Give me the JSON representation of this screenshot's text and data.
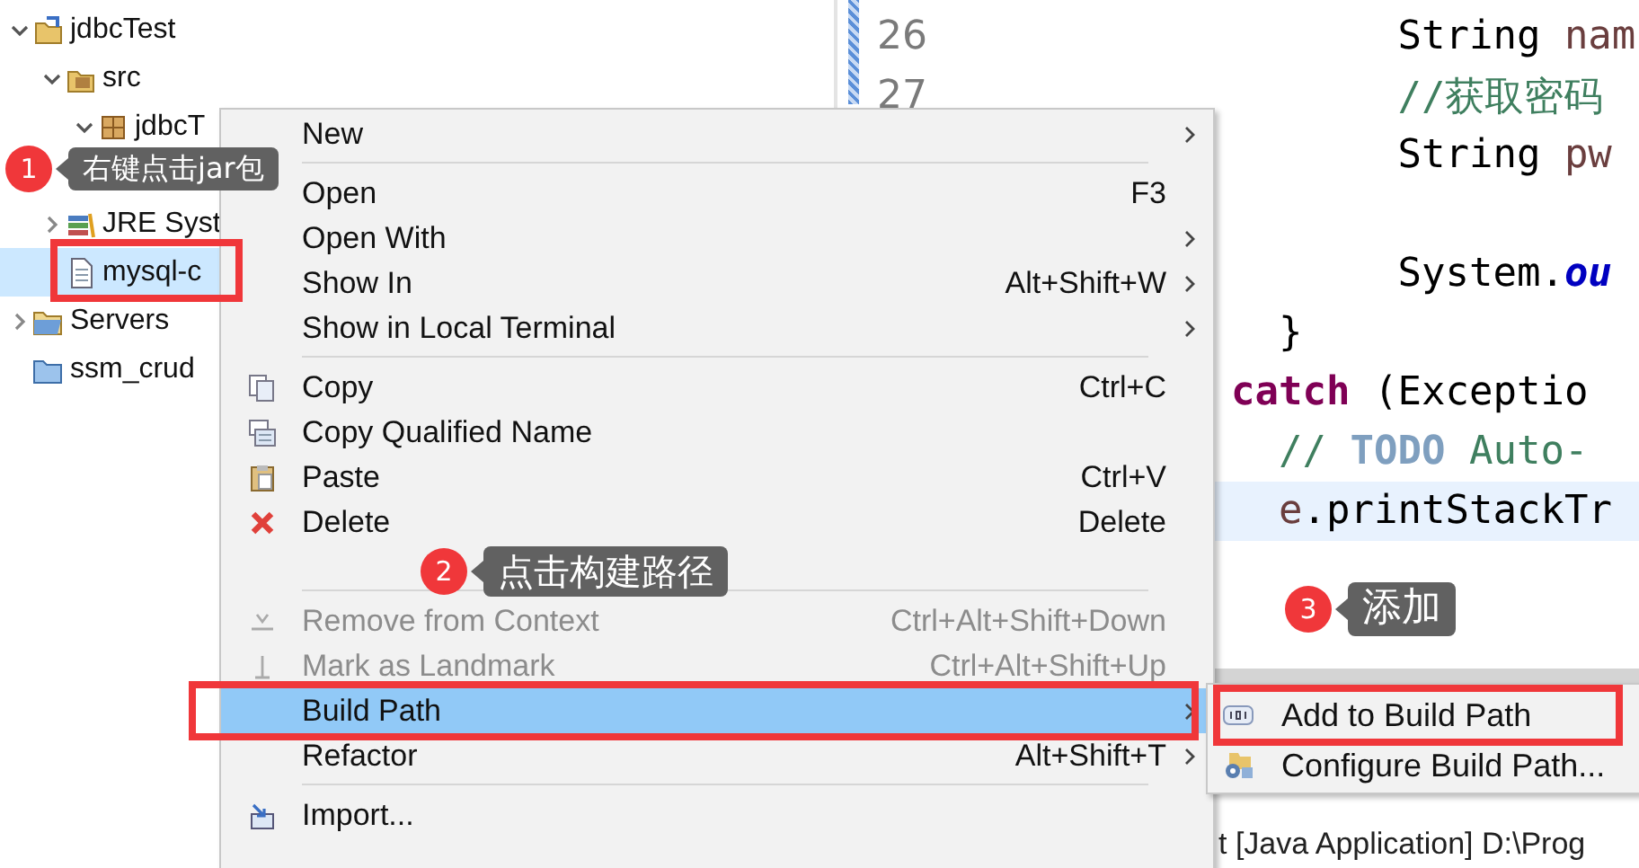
{
  "project_explorer": {
    "items": [
      {
        "label": "jdbcTest",
        "kind": "project",
        "expanded": true,
        "selected": false,
        "children": [
          {
            "label": "src",
            "kind": "sourcefolder",
            "expanded": true,
            "selected": false,
            "children": [
              {
                "label": "jdbcT",
                "kind": "package",
                "expanded": true,
                "selected": false
              }
            ]
          },
          {
            "label": "JRE Syst",
            "kind": "library",
            "expanded": false,
            "selected": false
          },
          {
            "label": "mysql-c",
            "kind": "jarfile",
            "selected": true
          }
        ]
      },
      {
        "label": "Servers",
        "kind": "serverfolder",
        "expanded": false,
        "selected": false
      },
      {
        "label": "ssm_crud",
        "kind": "folder",
        "selected": false
      }
    ]
  },
  "editor": {
    "lines": [
      {
        "number": "26",
        "kind": "inner",
        "current": false,
        "segments": [
          {
            "text": "String ",
            "kind": "plain"
          },
          {
            "text": "nam",
            "kind": "variable"
          }
        ]
      },
      {
        "number": "27",
        "kind": "inner",
        "current": false,
        "segments": [
          {
            "text": "//获取密码",
            "kind": "comment"
          }
        ]
      },
      {
        "kind": "inner",
        "current": false,
        "segments": [
          {
            "text": "String ",
            "kind": "plain"
          },
          {
            "text": "pw",
            "kind": "variable"
          }
        ]
      },
      {
        "kind": "inner",
        "current": false,
        "blank_before": true,
        "segments": [
          {
            "text": "System.",
            "kind": "plain"
          },
          {
            "text": "ou",
            "kind": "field"
          }
        ]
      },
      {
        "kind": "block",
        "current": false,
        "segments": [
          {
            "text": "}",
            "kind": "plain"
          }
        ]
      },
      {
        "kind": "outer",
        "current": false,
        "segments": [
          {
            "text": "catch",
            "kind": "keyword"
          },
          {
            "text": " (Exceptio",
            "kind": "plain"
          }
        ]
      },
      {
        "kind": "block",
        "current": false,
        "segments": [
          {
            "text": "// ",
            "kind": "comment"
          },
          {
            "text": "TODO",
            "kind": "todo"
          },
          {
            "text": " Auto-",
            "kind": "comment"
          }
        ]
      },
      {
        "kind": "block",
        "current": true,
        "segments": [
          {
            "text": "e",
            "kind": "variable"
          },
          {
            "text": ".printStackTr",
            "kind": "plain"
          }
        ]
      }
    ],
    "console_text": "t [Java Application] D:\\Prog"
  },
  "context_menu": {
    "items": [
      {
        "kind": "item",
        "label": "New",
        "submenu": true,
        "disabled": false,
        "selected": false
      },
      {
        "kind": "separator"
      },
      {
        "kind": "item",
        "label": "Open",
        "shortcut": "F3",
        "submenu": false,
        "disabled": false,
        "selected": false
      },
      {
        "kind": "item",
        "label": "Open With",
        "submenu": true,
        "disabled": false,
        "selected": false
      },
      {
        "kind": "item",
        "label": "Show In",
        "shortcut": "Alt+Shift+W",
        "submenu": true,
        "disabled": false,
        "selected": false
      },
      {
        "kind": "item",
        "label": "Show in Local Terminal",
        "submenu": true,
        "disabled": false,
        "selected": false
      },
      {
        "kind": "separator"
      },
      {
        "kind": "copy",
        "label": "Copy",
        "shortcut": "Ctrl+C",
        "submenu": false,
        "disabled": false,
        "selected": false
      },
      {
        "kind": "copyname",
        "label": "Copy Qualified Name",
        "submenu": false,
        "disabled": false,
        "selected": false
      },
      {
        "kind": "paste",
        "label": "Paste",
        "shortcut": "Ctrl+V",
        "submenu": false,
        "disabled": false,
        "selected": false
      },
      {
        "kind": "delete",
        "label": "Delete",
        "shortcut": "Delete",
        "submenu": false,
        "disabled": false,
        "selected": false
      },
      {
        "kind": "separator"
      },
      {
        "kind": "remove",
        "label": "Remove from Context",
        "shortcut": "Ctrl+Alt+Shift+Down",
        "submenu": false,
        "disabled": true,
        "selected": false
      },
      {
        "kind": "landmark",
        "label": "Mark as Landmark",
        "shortcut": "Ctrl+Alt+Shift+Up",
        "submenu": false,
        "disabled": true,
        "selected": false
      },
      {
        "kind": "item",
        "label": "Build Path",
        "submenu": true,
        "disabled": false,
        "selected": true
      },
      {
        "kind": "item",
        "label": "Refactor",
        "shortcut": "Alt+Shift+T",
        "submenu": true,
        "disabled": false,
        "selected": false
      },
      {
        "kind": "separator"
      },
      {
        "kind": "import",
        "label": "Import...",
        "submenu": false,
        "disabled": false,
        "selected": false
      }
    ]
  },
  "submenu": {
    "items": [
      {
        "label": "Add to Build Path",
        "kind": "jar",
        "selected": false
      },
      {
        "label": "Configure Build Path...",
        "kind": "configure",
        "selected": false
      }
    ]
  },
  "callouts": [
    {
      "number": "1",
      "text": "右键点击jar包"
    },
    {
      "number": "2",
      "text": "点击构建路径"
    },
    {
      "number": "3",
      "text": "添加"
    }
  ]
}
